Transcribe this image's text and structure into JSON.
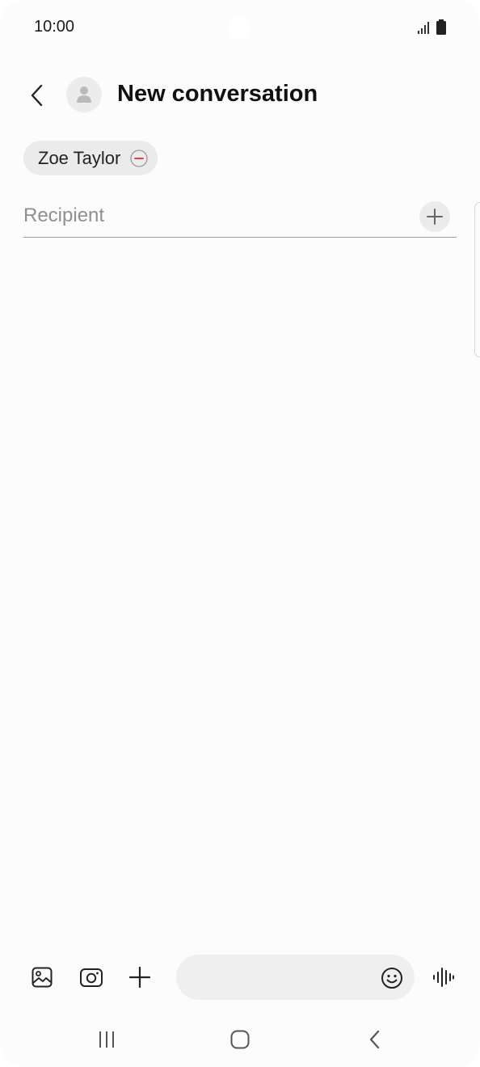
{
  "status_bar": {
    "time": "10:00",
    "icons": [
      "signal-icon",
      "battery-icon"
    ]
  },
  "header": {
    "back_icon": "chevron-left-icon",
    "avatar_icon": "person-icon",
    "title": "New conversation"
  },
  "recipients": {
    "chips": [
      {
        "label": "Zoe Taylor",
        "remove_icon": "minus-circle-icon",
        "remove_color": "#e0453a"
      }
    ],
    "input": {
      "placeholder": "Recipient",
      "value": ""
    },
    "add_icon": "plus-icon"
  },
  "compose": {
    "icons": [
      "gallery-icon",
      "camera-icon",
      "plus-icon",
      "emoji-icon",
      "voice-wave-icon"
    ],
    "message_placeholder": "",
    "message_value": ""
  },
  "navigation": {
    "icons": [
      "recent-apps-icon",
      "home-icon",
      "back-icon"
    ]
  },
  "colors": {
    "background": "#fcfcfc",
    "chip_background": "#ebebeb",
    "title_text": "#111111",
    "placeholder_text": "#8f8f8f",
    "accent_remove": "#e0453a"
  }
}
